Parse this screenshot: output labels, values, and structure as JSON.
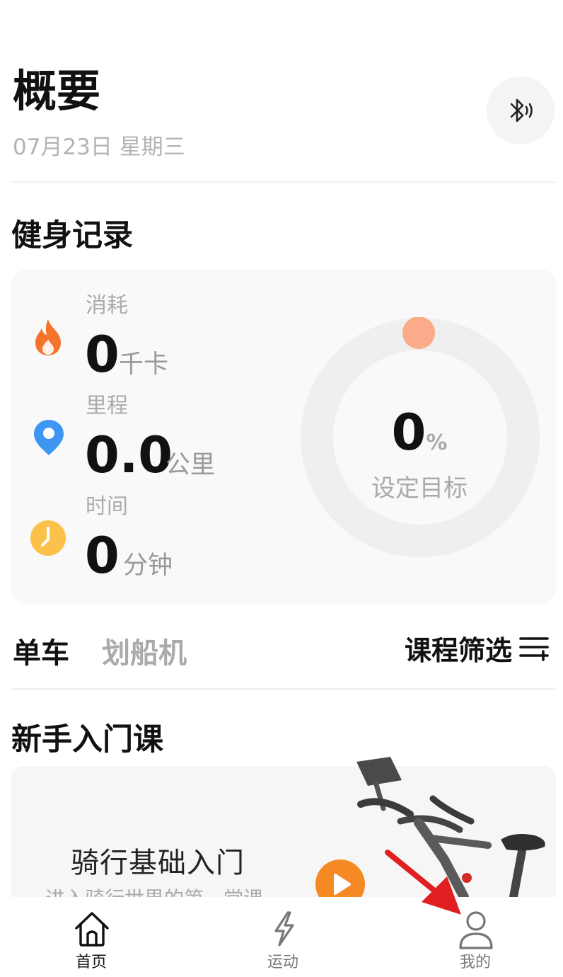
{
  "header": {
    "title": "概要",
    "date": "07月23日 星期三",
    "bluetooth_icon": "bluetooth-audio-icon"
  },
  "fitness": {
    "section_title": "健身记录",
    "metrics": [
      {
        "icon": "flame-icon",
        "label": "消耗",
        "value": "0",
        "unit": "千卡",
        "color": "#f5742a"
      },
      {
        "icon": "location-pin-icon",
        "label": "里程",
        "value": "0.0",
        "unit": "公里",
        "color": "#3d96f2"
      },
      {
        "icon": "clock-icon",
        "label": "时间",
        "value": "0",
        "unit": "分钟",
        "color": "#fbc14a"
      }
    ],
    "goal": {
      "percent": "0",
      "percent_sign": "%",
      "label": "设定目标",
      "progress": 0,
      "accent": "#fbab8a"
    }
  },
  "categories": {
    "tabs": [
      {
        "label": "单车",
        "active": true
      },
      {
        "label": "划船机",
        "active": false
      }
    ],
    "filter_label": "课程筛选"
  },
  "beginner": {
    "section_title": "新手入门课",
    "course": {
      "title": "骑行基础入门",
      "subtitle": "进入骑行世界的第一堂课"
    }
  },
  "nav": {
    "items": [
      {
        "label": "首页",
        "icon": "home-icon",
        "active": true
      },
      {
        "label": "运动",
        "icon": "lightning-icon",
        "active": false
      },
      {
        "label": "我的",
        "icon": "user-icon",
        "active": false
      }
    ]
  },
  "colors": {
    "accent": "#f58a24",
    "annotation_arrow": "#e02020"
  }
}
